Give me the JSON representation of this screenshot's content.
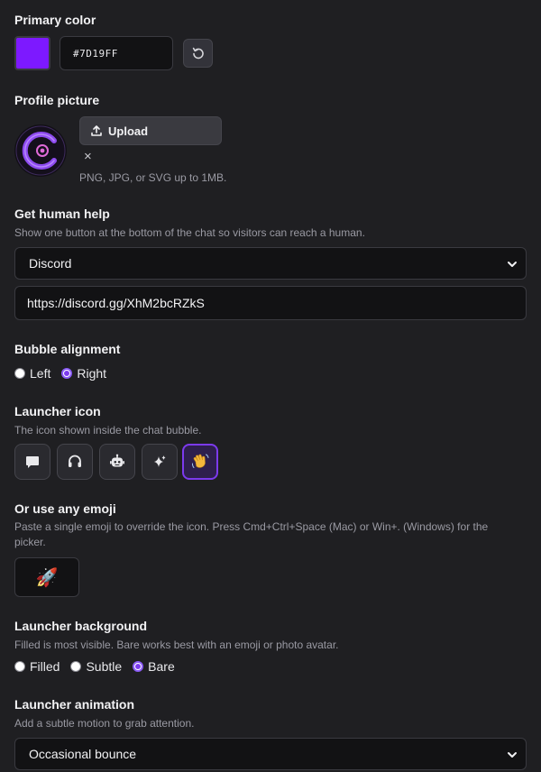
{
  "primary_color": {
    "label": "Primary color",
    "value": "#7D19FF",
    "swatch_color": "#7D19FF"
  },
  "profile_picture": {
    "label": "Profile picture",
    "upload_label": "Upload",
    "remove_label": "×",
    "hint": "PNG, JPG, or SVG up to 1MB."
  },
  "human_help": {
    "label": "Get human help",
    "help": "Show one button at the bottom of the chat so visitors can reach a human.",
    "selected": "Discord",
    "url": "https://discord.gg/XhM2bcRZkS"
  },
  "bubble_alignment": {
    "label": "Bubble alignment",
    "options": [
      {
        "label": "Left",
        "checked": false
      },
      {
        "label": "Right",
        "checked": true
      }
    ]
  },
  "launcher_icon": {
    "label": "Launcher icon",
    "help": "The icon shown inside the chat bubble.",
    "icons": [
      "chat-bubble-icon",
      "headset-icon",
      "bot-icon",
      "sparkles-icon",
      "waving-hand-icon"
    ],
    "selected": "waving-hand-icon"
  },
  "emoji": {
    "label": "Or use any emoji",
    "help": "Paste a single emoji to override the icon. Press Cmd+Ctrl+Space (Mac) or Win+. (Windows) for the picker.",
    "value": "🚀"
  },
  "launcher_background": {
    "label": "Launcher background",
    "help": "Filled is most visible. Bare works best with an emoji or photo avatar.",
    "options": [
      {
        "label": "Filled",
        "checked": false
      },
      {
        "label": "Subtle",
        "checked": false
      },
      {
        "label": "Bare",
        "checked": true
      }
    ]
  },
  "launcher_animation": {
    "label": "Launcher animation",
    "help": "Add a subtle motion to grab attention.",
    "selected": "Occasional bounce"
  },
  "colors": {
    "accent": "#7c3aed",
    "background": "#1f1f22",
    "field": "#121214"
  }
}
